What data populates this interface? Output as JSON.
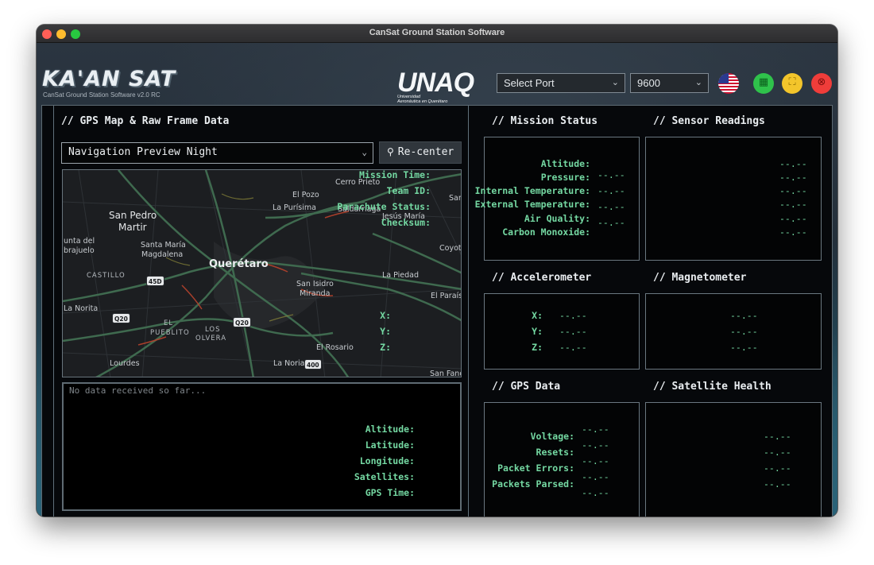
{
  "window": {
    "title": "CanSat Ground Station Software"
  },
  "header": {
    "logo_text": "KA'AN SAT",
    "subtitle": "CanSat Ground Station Software v2.0 RC",
    "university_logo": {
      "main": "UNAQ",
      "line1": "Universidad",
      "line2": "Aeronáutica en Querétaro"
    },
    "port_select": {
      "value": "Select Port"
    },
    "baud_select": {
      "value": "9600"
    },
    "buttons": [
      {
        "name": "language-flag-button",
        "icon": "us-flag-icon"
      },
      {
        "name": "export-csv-button",
        "icon": "spreadsheet-icon",
        "color": "#2fc24b"
      },
      {
        "name": "fullscreen-button",
        "icon": "expand-icon",
        "color": "#f3c52b"
      },
      {
        "name": "close-app-button",
        "icon": "close-icon",
        "color": "#ef3d3a"
      }
    ]
  },
  "gps_panel": {
    "title": "// GPS Map & Raw Frame Data",
    "map_style_select": {
      "value": "Navigation Preview Night"
    },
    "recenter_label": "Re-center",
    "map_labels": {
      "cerro_prieto": "Cerro Prieto",
      "el_pozo": "El Pozo",
      "la_purisima": "La Purísima",
      "saldarriaga": "Saldarriaga",
      "jesus_maria": "Jesús María",
      "san": "San",
      "san_pedro": "San Pedro",
      "martir": "Martir",
      "santa_maria": "Santa María",
      "magdalena": "Magdalena",
      "punta_del": "unta del",
      "brajuelo": "brajuelo",
      "coyotillos": "Coyoti",
      "castillo": "CASTILLO",
      "queretaro": "Querétaro",
      "la_piedad": "La Piedad",
      "san_isidro": "San Isidro",
      "miranda": "Miranda",
      "el_paraiso": "El Paraís",
      "la_norita": "La Norita",
      "el": "EL",
      "pueblito": "PUEBLITO",
      "los": "LOS",
      "olvera": "OLVERA",
      "el_rosario": "El Rosario",
      "lourdes": "Lourdes",
      "la_noria": "La Noria",
      "san_fande": "San Fand",
      "shield_45d": "45D",
      "shield_q20a": "Q20",
      "shield_q20b": "Q20",
      "shield_400": "400"
    },
    "raw_frame_placeholder": "No data received so far..."
  },
  "mission_status": {
    "title": "// Mission Status",
    "rows": [
      {
        "label": "Mission Time:",
        "value": "--.--"
      },
      {
        "label": "Team ID:",
        "value": "--.--"
      },
      {
        "label": "Parachute Status:",
        "value": "--.--"
      },
      {
        "label": "Checksum:",
        "value": "--.--"
      }
    ]
  },
  "sensor_readings": {
    "title": "// Sensor Readings",
    "rows": [
      {
        "label": "Altitude:",
        "value": "--.--"
      },
      {
        "label": "Pressure:",
        "value": "--.--"
      },
      {
        "label": "Internal Temperature:",
        "value": "--.--"
      },
      {
        "label": "External Temperature:",
        "value": "--.--"
      },
      {
        "label": "Air Quality:",
        "value": "--.--"
      },
      {
        "label": "Carbon Monoxide:",
        "value": "--.--"
      }
    ]
  },
  "accelerometer": {
    "title": "// Accelerometer",
    "rows": [
      {
        "label": "X:",
        "value": "--.--"
      },
      {
        "label": "Y:",
        "value": "--.--"
      },
      {
        "label": "Z:",
        "value": "--.--"
      }
    ]
  },
  "magnetometer": {
    "title": "// Magnetometer",
    "rows": [
      {
        "label": "X:",
        "value": "--.--"
      },
      {
        "label": "Y:",
        "value": "--.--"
      },
      {
        "label": "Z:",
        "value": "--.--"
      }
    ]
  },
  "gps_data": {
    "title": "// GPS Data",
    "rows": [
      {
        "label": "Altitude:",
        "value": "--.--"
      },
      {
        "label": "Latitude:",
        "value": "--.--"
      },
      {
        "label": "Longitude:",
        "value": "--.--"
      },
      {
        "label": "Satellites:",
        "value": "--.--"
      },
      {
        "label": "GPS Time:",
        "value": "--.--"
      }
    ]
  },
  "satellite_health": {
    "title": "// Satellite Health",
    "rows": [
      {
        "label": "Voltage:",
        "value": "--.--"
      },
      {
        "label": "Resets:",
        "value": "--.--"
      },
      {
        "label": "Packet Errors:",
        "value": "--.--"
      },
      {
        "label": "Packets Parsed:",
        "value": "--.--"
      }
    ]
  },
  "colors": {
    "value_text": "#74d8a2",
    "panel_border": "#6a7780"
  }
}
